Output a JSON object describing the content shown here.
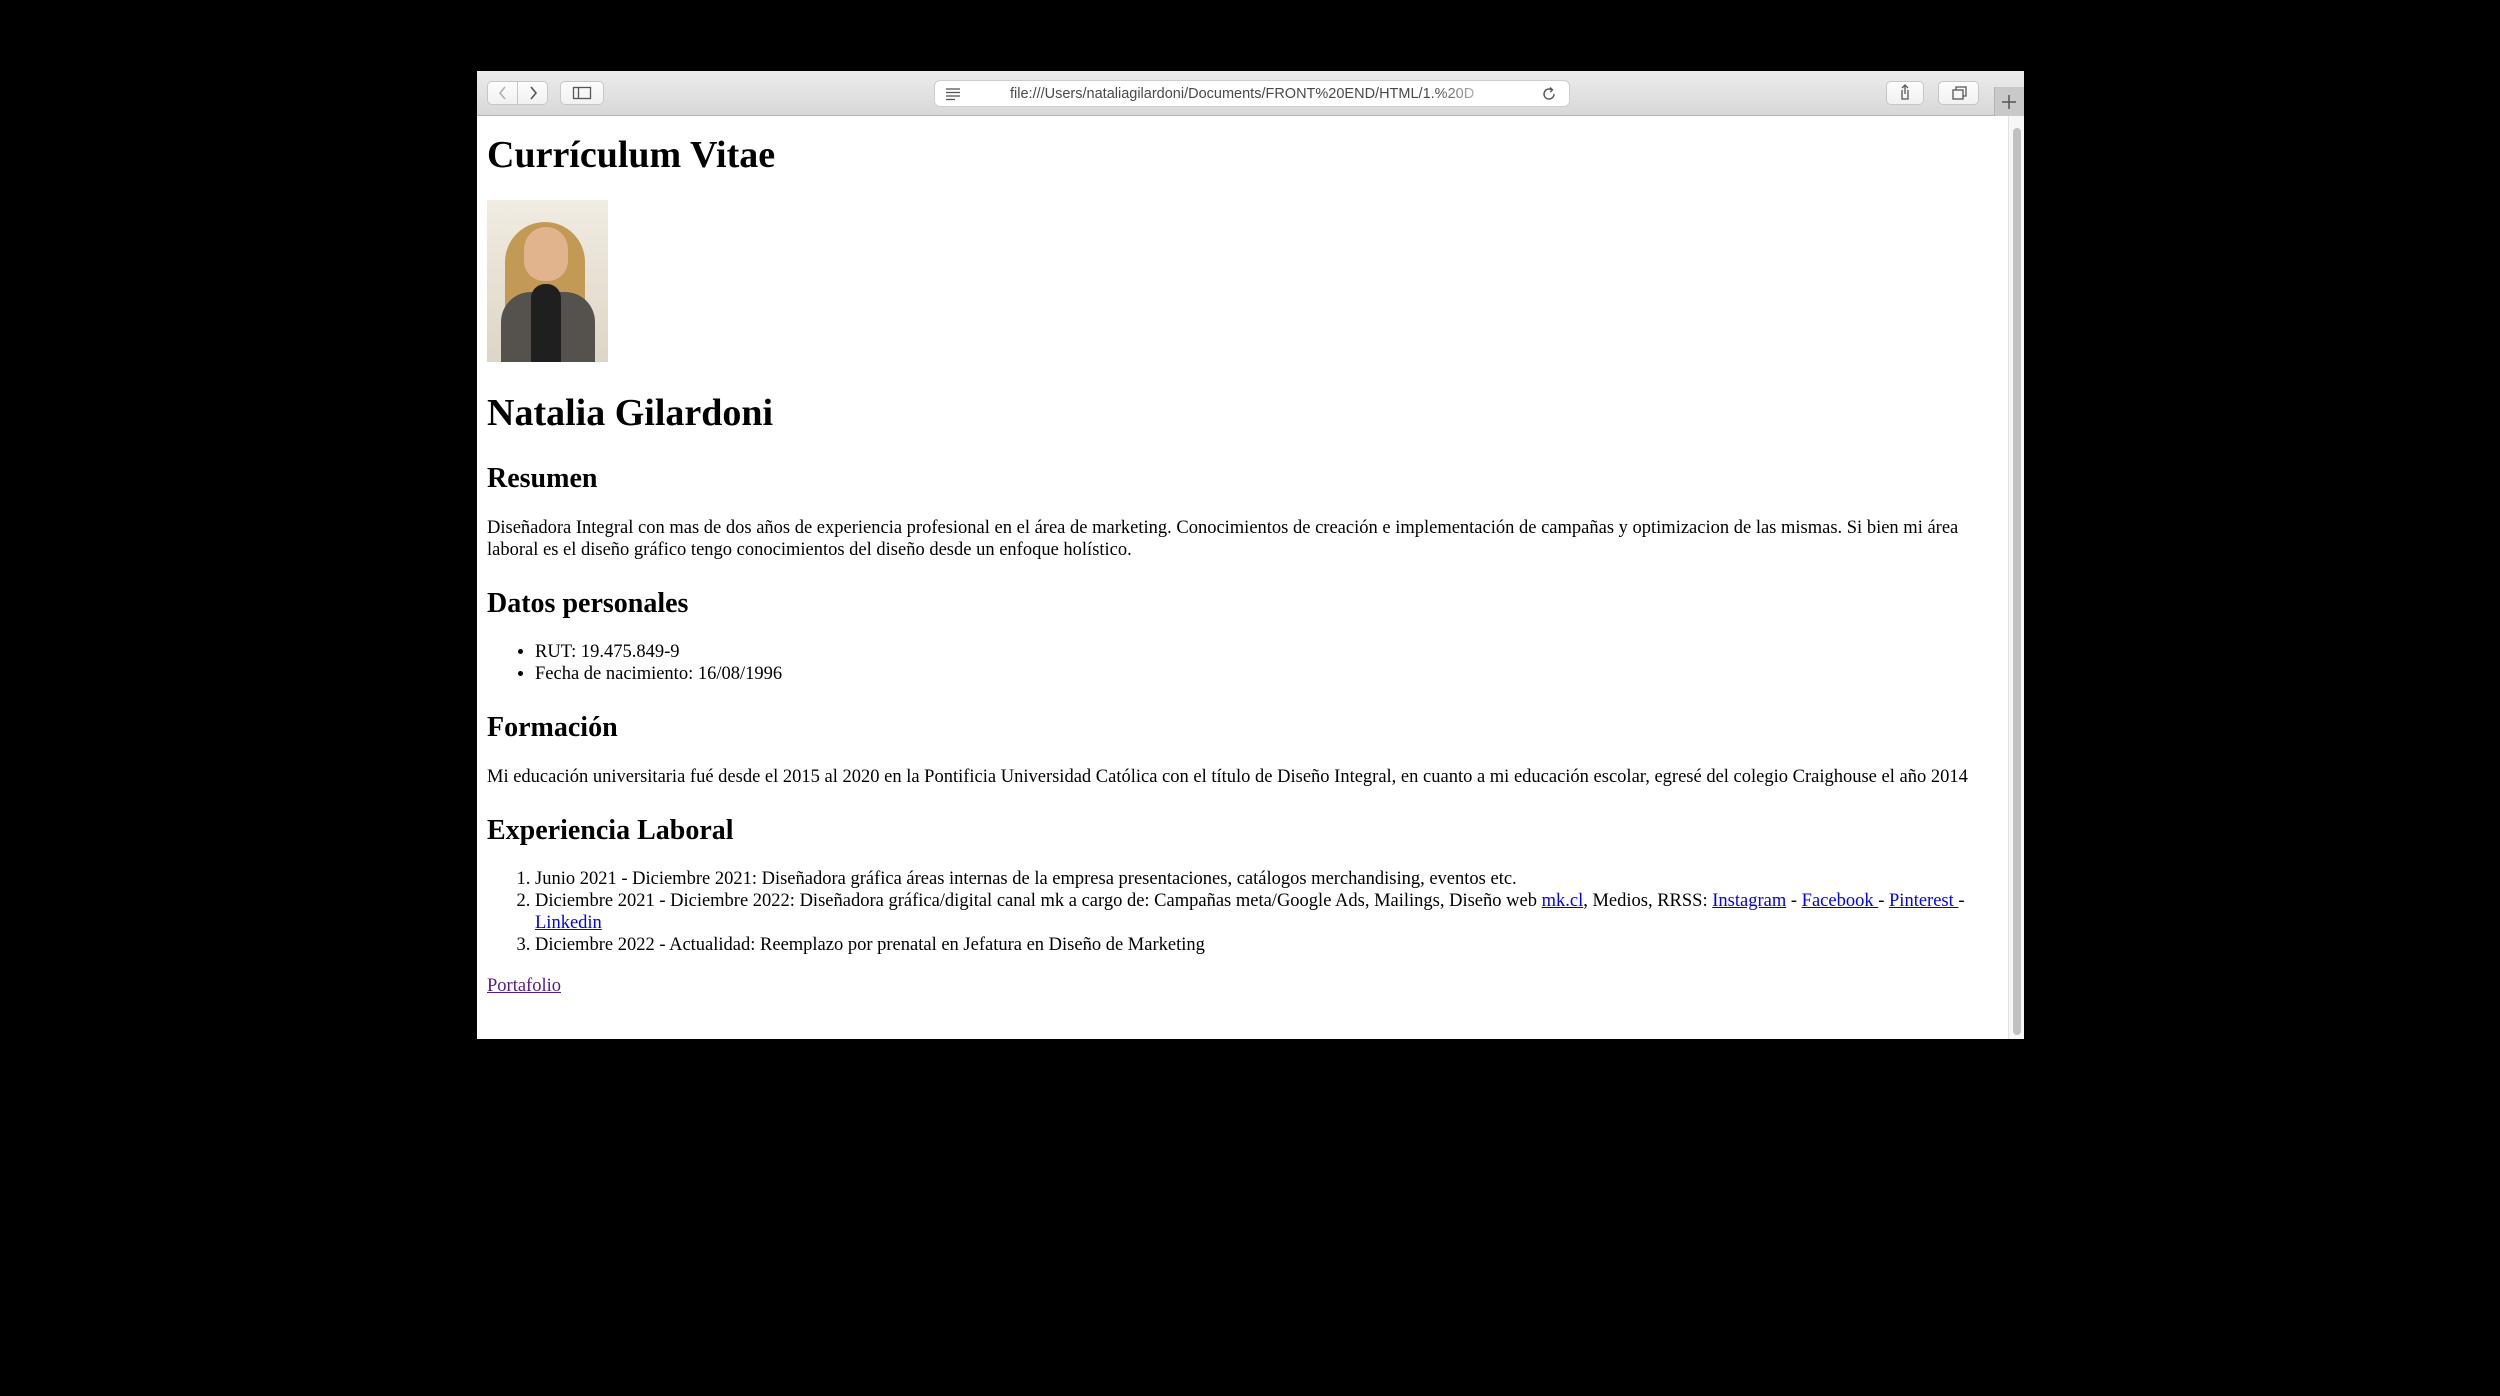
{
  "browser": {
    "url": "file:///Users/nataliagilardoni/Documents/FRONT%20END/HTML/1.%20D"
  },
  "page": {
    "title": "Currículum Vitae",
    "name": "Natalia Gilardoni",
    "resumen": {
      "heading": "Resumen",
      "text": "Diseñadora Integral con mas de dos años de experiencia profesional en el área de marketing. Conocimientos de creación e implementación de campañas y optimizacion de las mismas. Si bien mi área laboral es el diseño gráfico tengo conocimientos del diseño desde un enfoque holístico."
    },
    "datos": {
      "heading": "Datos personales",
      "items": [
        "RUT: 19.475.849-9",
        "Fecha de nacimiento: 16/08/1996"
      ]
    },
    "formacion": {
      "heading": "Formación",
      "text": "Mi educación universitaria fué desde el 2015 al 2020 en la Pontificia Universidad Católica con el título de Diseño Integral, en cuanto a mi educación escolar, egresé del colegio Craighouse el año 2014"
    },
    "experiencia": {
      "heading": "Experiencia Laboral",
      "item1": "Junio 2021 - Diciembre 2021: Diseñadora gráfica áreas internas de la empresa presentaciones, catálogos merchandising, eventos etc.",
      "item2": {
        "text_before": "Diciembre 2021 - Diciembre 2022: Diseñadora gráfica/digital canal mk a cargo de: Campañas meta/Google Ads, Mailings, Diseño web ",
        "link_mk": "mk.cl",
        "text_mid": ", Medios, RRSS: ",
        "link_instagram": "Instagram",
        "sep1": " - ",
        "link_facebook": "Facebook ",
        "sep2": "- ",
        "link_pinterest": "Pinterest ",
        "sep3": "- ",
        "link_linkedin": "Linkedin"
      },
      "item3": "Diciembre 2022 - Actualidad: Reemplazo por prenatal en Jefatura en Diseño de Marketing"
    },
    "portfolio_link": "Portafolio"
  },
  "icons": {
    "back": "chevron-left-icon",
    "forward": "chevron-right-icon",
    "sidebar": "sidebar-icon",
    "reader": "reader-icon",
    "reload": "reload-icon",
    "share": "share-icon",
    "tabs": "tabs-icon",
    "new_tab": "plus-icon"
  },
  "colors": {
    "link": "#0000ee",
    "visited_link": "#551a8b",
    "backdrop": "#000000"
  }
}
